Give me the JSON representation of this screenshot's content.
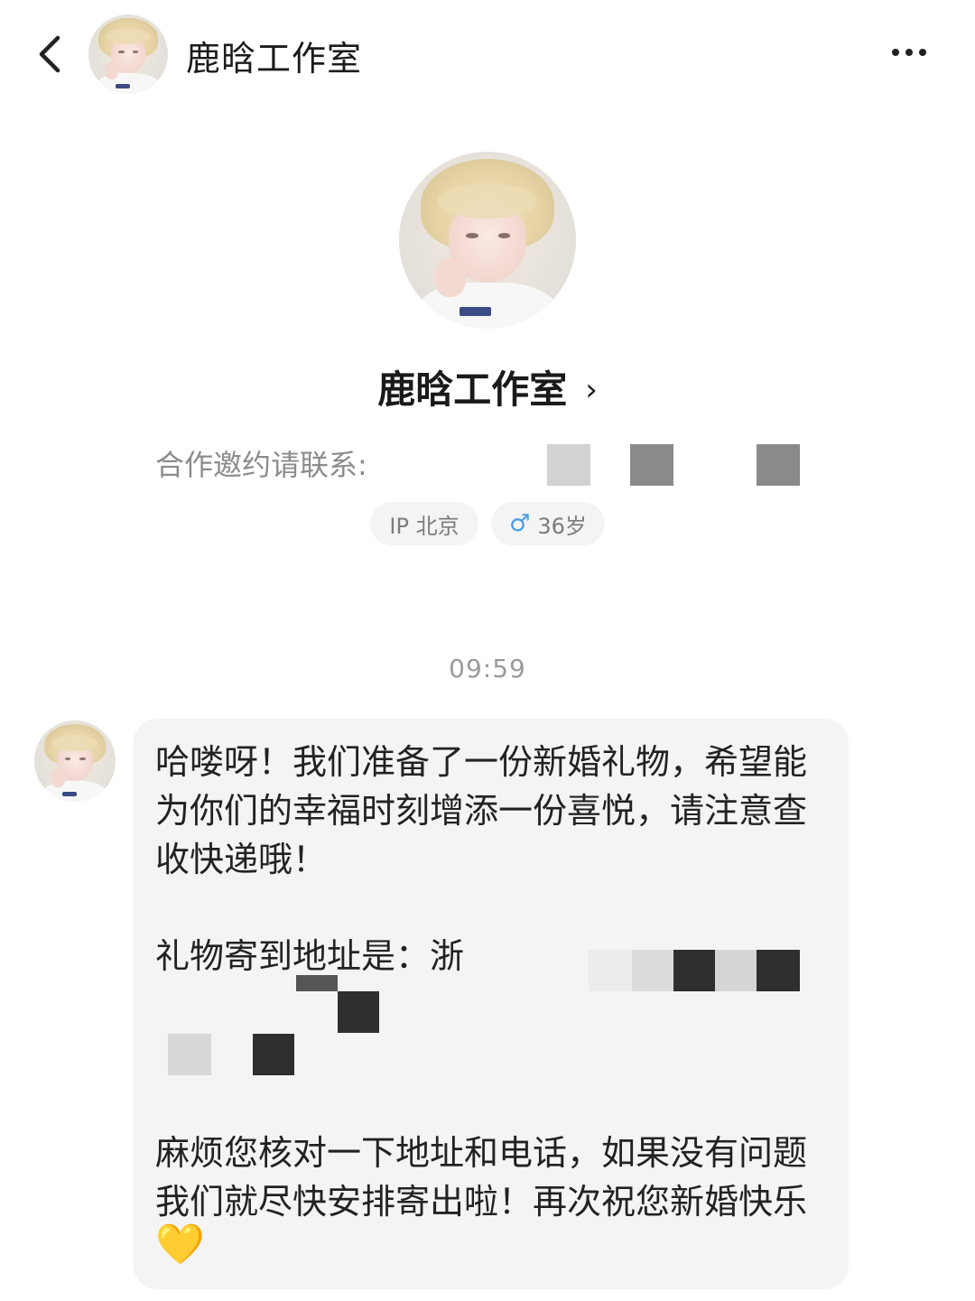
{
  "header": {
    "title": "鹿晗工作室",
    "back_icon": "chevron-left-icon",
    "more_icon": "more-horizontal-icon"
  },
  "profile": {
    "name": "鹿晗工作室",
    "chevron": "›",
    "contact_label": "合作邀约请联系:",
    "ip_badge": "IP 北京",
    "age_badge": "36岁",
    "gender_icon": "male-icon",
    "gender_symbol": "♂"
  },
  "chat": {
    "timestamp": "09:59",
    "message": {
      "para1": "哈喽呀！我们准备了一份新婚礼物，希望能为你们的幸福时刻增添一份喜悦，请注意查收快递哦！",
      "address_prefix": "礼物寄到地址是：浙",
      "para3_line1": "麻烦您核对一下地址和电话，如果没有问题",
      "para3_line2": "我们就尽快安排寄出啦！再次祝您新婚快乐",
      "emoji": "💛"
    }
  },
  "colors": {
    "bubble_bg": "#f4f4f4",
    "chip_bg": "#f4f4f4",
    "male_icon": "#4a9be8",
    "mosaic_dark": "#2f2f2f",
    "mosaic_mid": "#8a8a8a",
    "mosaic_light": "#d2d2d2"
  }
}
